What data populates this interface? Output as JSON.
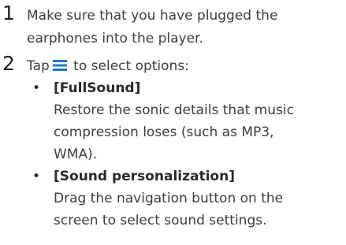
{
  "steps": [
    {
      "number": "1",
      "lines": [
        "Make sure that you have plugged the",
        "earphones into the player."
      ]
    },
    {
      "number": "2",
      "before_icon": "Tap",
      "icon": "menu-icon",
      "after_icon": "to select options:",
      "options": [
        {
          "bullet": "•",
          "title": "[FullSound]",
          "description": [
            "Restore the sonic details that music",
            "compression loses (such as MP3,",
            "WMA)."
          ]
        },
        {
          "bullet": "•",
          "title": "[Sound personalization]",
          "description": [
            "Drag the navigation button on the",
            "screen to select sound settings."
          ]
        }
      ]
    }
  ],
  "colors": {
    "text": "#3d3d3d",
    "icon": "#1d78c9"
  }
}
